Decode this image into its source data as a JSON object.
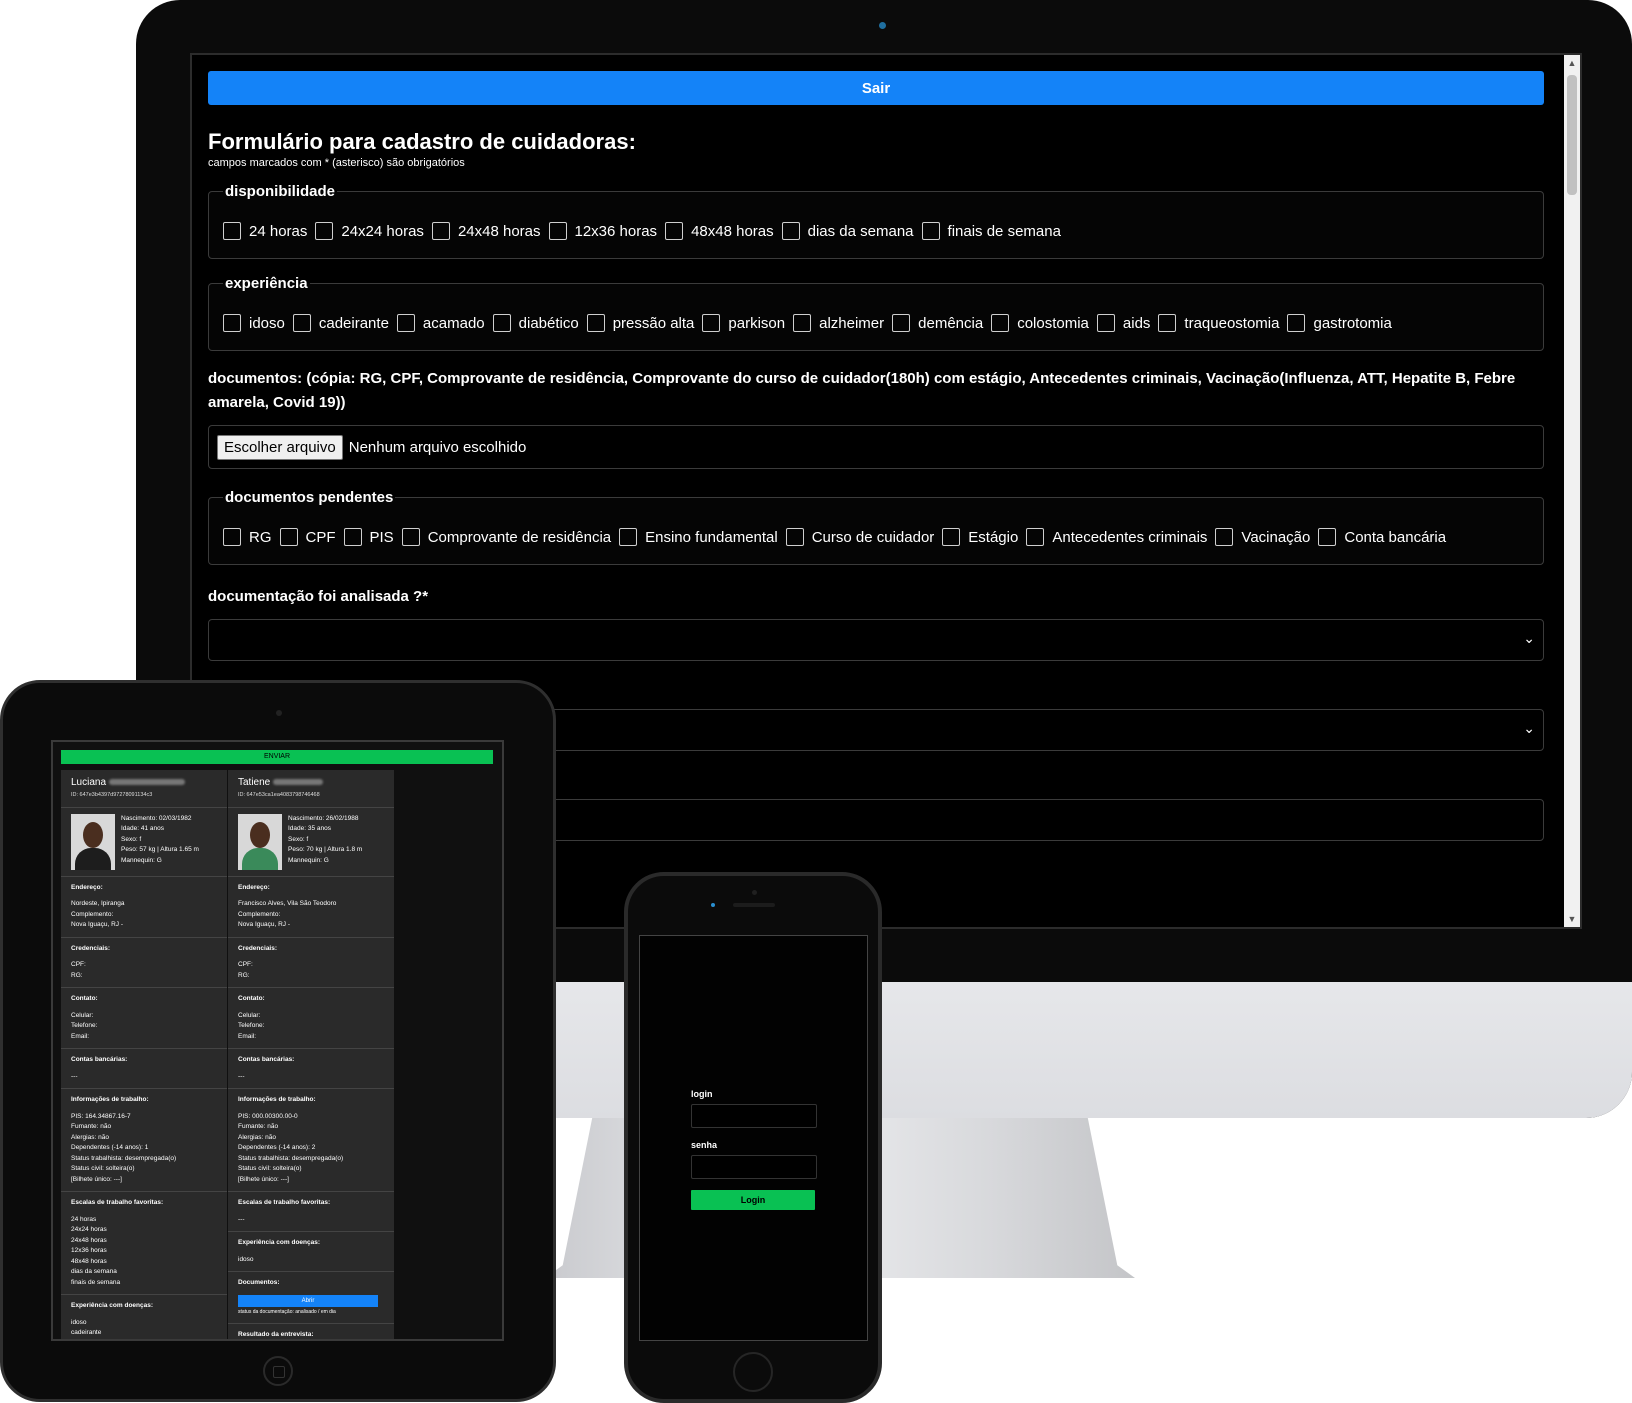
{
  "desktop": {
    "logout_label": "Sair",
    "form_title": "Formulário para cadastro de cuidadoras:",
    "form_subtitle": "campos marcados com * (asterisco) são obrigatórios",
    "availability": {
      "legend": "disponibilidade",
      "options": [
        "24 horas",
        "24x24 horas",
        "24x48 horas",
        "12x36 horas",
        "48x48 horas",
        "dias da semana",
        "finais de semana"
      ]
    },
    "experience": {
      "legend": "experiência",
      "options": [
        "idoso",
        "cadeirante",
        "acamado",
        "diabético",
        "pressão alta",
        "parkison",
        "alzheimer",
        "demência",
        "colostomia",
        "aids",
        "traqueostomia",
        "gastrotomia"
      ]
    },
    "documents": {
      "label": "documentos: (cópia: RG, CPF, Comprovante de residência, Comprovante do curso de cuidador(180h) com estágio, Antecedentes criminais, Vacinação(Influenza, ATT, Hepatite B, Febre amarela, Covid 19))",
      "file_button": "Escolher arquivo",
      "file_status": "Nenhum arquivo escolhido"
    },
    "pending_documents": {
      "legend": "documentos pendentes",
      "options": [
        "RG",
        "CPF",
        "PIS",
        "Comprovante de residência",
        "Ensino fundamental",
        "Curso de cuidador",
        "Estágio",
        "Antecedentes criminais",
        "Vacinação",
        "Conta bancária"
      ]
    },
    "analysis_label": "documentação foi analisada ?*"
  },
  "tablet": {
    "send_label": "ENVIAR",
    "cards": [
      {
        "name": "Luciana",
        "id": "ID: 647e3b4397d97278091134c3",
        "details": [
          "Nascimento: 02/03/1982",
          "Idade: 41 anos",
          "Sexo: f",
          "Peso: 57 kg | Altura 1.65 m",
          "Mannequin: G"
        ],
        "address_title": "Endereço:",
        "address": [
          "Nordeste, Ipiranga",
          "Complemento:",
          "Nova Iguaçu, RJ -"
        ],
        "credentials_title": "Credenciais:",
        "credentials": [
          "CPF:",
          "RG:"
        ],
        "contact_title": "Contato:",
        "contact": [
          "Celular:",
          "Telefone:",
          "Email:"
        ],
        "bank_title": "Contas bancárias:",
        "bank": [
          "---"
        ],
        "work_title": "Informações de trabalho:",
        "work": [
          "PIS: 164.34867.16-7",
          "Fumante: não",
          "Alergias: não",
          "Dependentes (-14 anos): 1",
          "Status trabalhista: desempregada(o)",
          "Status civil: solteira(o)",
          "[Bilhete único: ---]"
        ],
        "shifts_title": "Escalas de trabalho favoritas:",
        "shifts": [
          "24 horas",
          "24x24 horas",
          "24x48 horas",
          "12x36 horas",
          "48x48 horas",
          "dias da semana",
          "finais de semana"
        ],
        "disease_title": "Experiência com doenças:",
        "diseases": [
          "idoso",
          "cadeirante"
        ]
      },
      {
        "name": "Tatiene",
        "id": "ID: 647e53ca1ea4083798746468",
        "details": [
          "Nascimento: 26/02/1988",
          "Idade: 35 anos",
          "Sexo: f",
          "Peso: 70 kg | Altura 1.8 m",
          "Mannequin: G"
        ],
        "address_title": "Endereço:",
        "address": [
          "Francisco Alves, Vila São Teodoro",
          "Complemento:",
          "Nova Iguaçu, RJ -"
        ],
        "credentials_title": "Credenciais:",
        "credentials": [
          "CPF:",
          "RG:"
        ],
        "contact_title": "Contato:",
        "contact": [
          "Celular:",
          "Telefone:",
          "Email:"
        ],
        "bank_title": "Contas bancárias:",
        "bank": [
          "---"
        ],
        "work_title": "Informações de trabalho:",
        "work": [
          "PIS: 000.00300.00-0",
          "Fumante: não",
          "Alergias: não",
          "Dependentes (-14 anos): 2",
          "Status trabalhista: desempregada(o)",
          "Status civil: solteira(o)",
          "[Bilhete único: ---]"
        ],
        "shifts_title": "Escalas de trabalho favoritas:",
        "shifts": [
          "---"
        ],
        "disease_title": "Experiência com doenças:",
        "diseases": [
          "idoso"
        ],
        "documents_title": "Documentos:",
        "open_label": "Abrir",
        "documents_status": "status da documentação: analisado / em dia",
        "interview_title": "Resultado da entrevista:"
      }
    ]
  },
  "phone": {
    "login_label": "login",
    "password_label": "senha",
    "login_button": "Login"
  },
  "colors": {
    "primary_blue": "#1483f8",
    "accent_green": "#09c153",
    "background": "#000000"
  }
}
